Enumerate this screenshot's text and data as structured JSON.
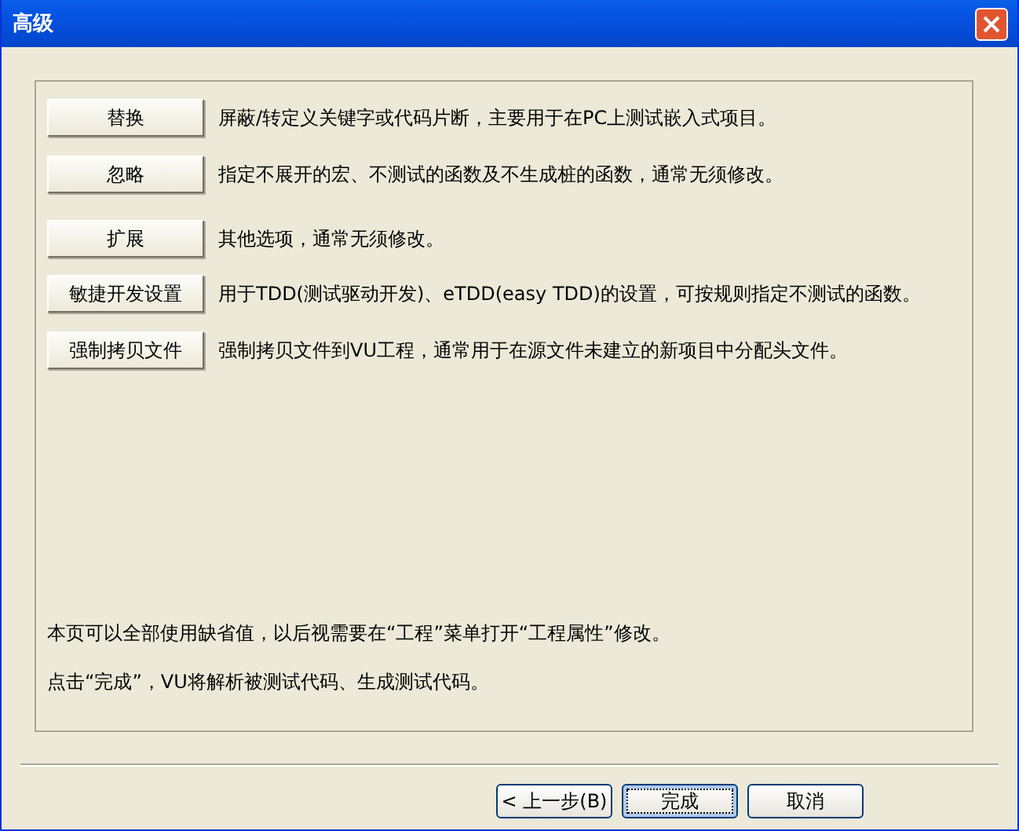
{
  "window": {
    "title": "高级"
  },
  "options": [
    {
      "button": "替换",
      "description": "屏蔽/转定义关键字或代码片断，主要用于在PC上测试嵌入式项目。"
    },
    {
      "button": "忽略",
      "description": "指定不展开的宏、不测试的函数及不生成桩的函数，通常无须修改。"
    },
    {
      "button": "扩展",
      "description": "其他选项，通常无须修改。"
    },
    {
      "button": "敏捷开发设置",
      "description": "用于TDD(测试驱动开发)、eTDD(easy TDD)的设置，可按规则指定不测试的函数。"
    },
    {
      "button": "强制拷贝文件",
      "description": "强制拷贝文件到VU工程，通常用于在源文件未建立的新项目中分配头文件。"
    }
  ],
  "notes": [
    "本页可以全部使用缺省值，以后视需要在“工程”菜单打开“工程属性”修改。",
    "点击“完成”，VU将解析被测试代码、生成测试代码。"
  ],
  "buttons": [
    {
      "label": "< 上一步(B)",
      "selected": false
    },
    {
      "label": "完成",
      "selected": true
    },
    {
      "label": "取消",
      "selected": false
    }
  ]
}
